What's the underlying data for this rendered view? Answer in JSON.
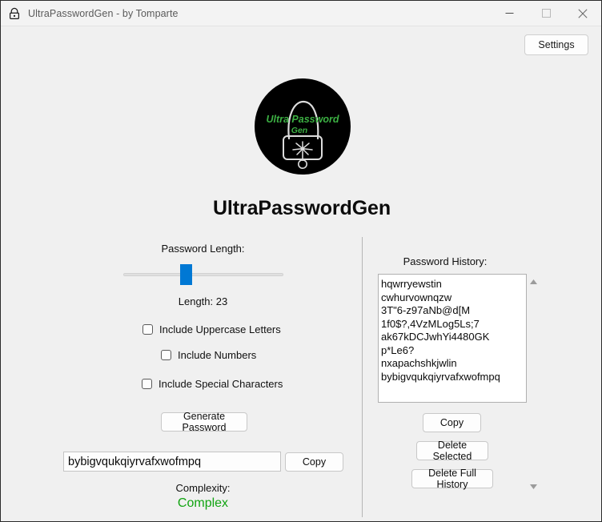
{
  "window": {
    "title": "UltraPasswordGen - by Tomparte",
    "icon": "lock-icon",
    "controls": {
      "minimize": "minimize-icon",
      "maximize": "maximize-icon",
      "close": "close-icon"
    }
  },
  "header": {
    "settings_label": "Settings",
    "app_title": "UltraPasswordGen",
    "logo": {
      "alt": "ultrapasswordgen-logo",
      "text_line1": "Ultra Password",
      "text_line2": "Gen",
      "circle_color": "#000000",
      "text_color": "#3cb043",
      "lock_color": "#e8e8e8"
    }
  },
  "left_panel": {
    "length_label": "Password Length:",
    "slider": {
      "value": 23,
      "min": 4,
      "max": 64,
      "percent": 35,
      "thumb_color": "#0078d4",
      "track_color": "#e0e0e0"
    },
    "length_value_label": "Length: 23",
    "options": [
      {
        "label": "Include Uppercase Letters",
        "checked": false
      },
      {
        "label": "Include Numbers",
        "checked": false
      },
      {
        "label": "Include Special Characters",
        "checked": false
      }
    ],
    "generate_label": "Generate Password",
    "password_value": "bybigvqukqiyrvafxwofmpq",
    "copy_label": "Copy",
    "complexity_label": "Complexity:",
    "complexity_value": "Complex",
    "complexity_color": "#11a411"
  },
  "right_panel": {
    "history_label": "Password History:",
    "history": [
      "hqwrryewstin",
      "cwhurvownqzw",
      "3T\"6-z97aNb@d[M",
      "1f0$?,4VzMLog5Ls;7",
      "ak67kDCJwhYi4480GK",
      "p*Le6?",
      "nxapachshkjwlin",
      "bybigvqukqiyrvafxwofmpq"
    ],
    "copy_label": "Copy",
    "delete_selected_label": "Delete Selected",
    "delete_full_label": "Delete Full History",
    "scrollbar": {
      "up_icon": "scroll-up-arrow-icon",
      "down_icon": "scroll-down-arrow-icon"
    }
  }
}
